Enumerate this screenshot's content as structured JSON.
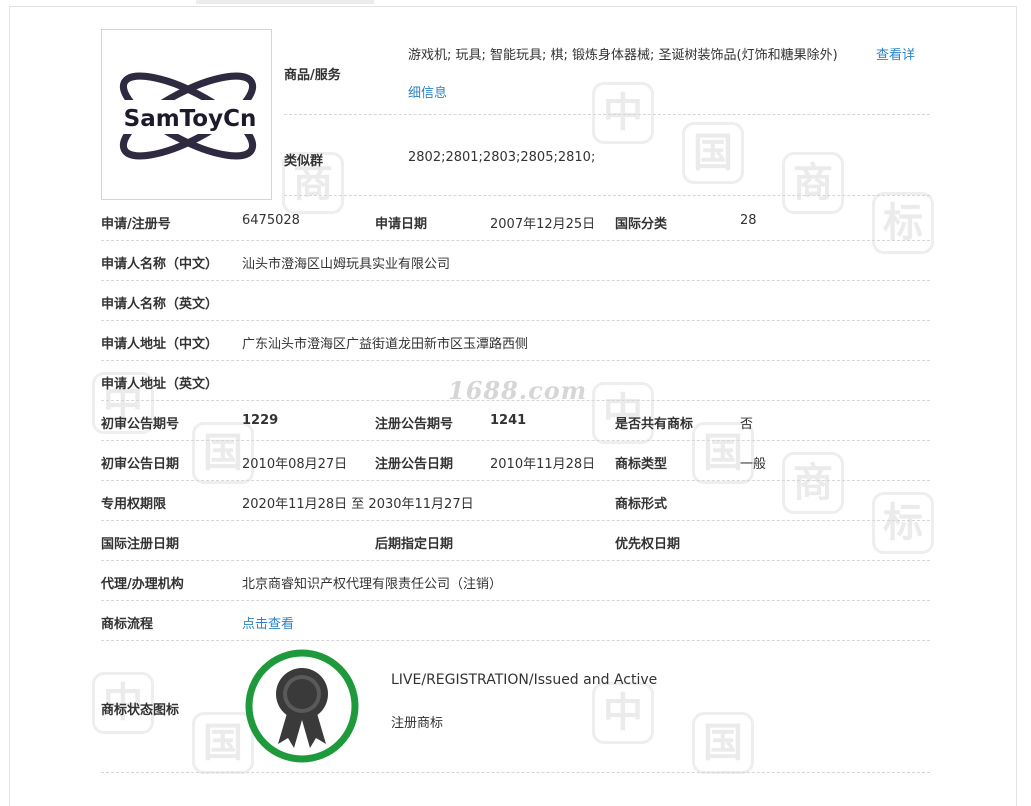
{
  "logo": {
    "text": "SamToyCn"
  },
  "goods": {
    "label": "商品/服务",
    "value": "游戏机; 玩具; 智能玩具; 棋; 锻炼身体器械; 圣诞树装饰品(灯饰和糖果除外)",
    "more_link_1": "查看详",
    "more_link_2": "细信息"
  },
  "similar_group": {
    "label": "类似群",
    "value": "2802;2801;2803;2805;2810;"
  },
  "reg_no": {
    "label": "申请/注册号",
    "value": "6475028"
  },
  "apply_date": {
    "label": "申请日期",
    "value": "2007年12月25日"
  },
  "intl_class": {
    "label": "国际分类",
    "value": "28"
  },
  "applicant_cn": {
    "label": "申请人名称（中文）",
    "value": "汕头市澄海区山姆玩具实业有限公司"
  },
  "applicant_en": {
    "label": "申请人名称（英文）",
    "value": ""
  },
  "address_cn": {
    "label": "申请人地址（中文）",
    "value": "广东汕头市澄海区广益街道龙田新市区玉潭路西侧"
  },
  "address_en": {
    "label": "申请人地址（英文）",
    "value": ""
  },
  "prelim_issue": {
    "label": "初审公告期号",
    "value": "1229"
  },
  "reg_issue": {
    "label": "注册公告期号",
    "value": "1241"
  },
  "shared": {
    "label": "是否共有商标",
    "value": "否"
  },
  "prelim_date": {
    "label": "初审公告日期",
    "value": "2010年08月27日"
  },
  "reg_date": {
    "label": "注册公告日期",
    "value": "2010年11月28日"
  },
  "tm_type": {
    "label": "商标类型",
    "value": "一般"
  },
  "exclusive_period": {
    "label": "专用权期限",
    "value": "2020年11月28日 至 2030年11月27日"
  },
  "tm_form": {
    "label": "商标形式",
    "value": ""
  },
  "intl_reg_date": {
    "label": "国际注册日期",
    "value": ""
  },
  "later_designation": {
    "label": "后期指定日期",
    "value": ""
  },
  "priority_date": {
    "label": "优先权日期",
    "value": ""
  },
  "agency": {
    "label": "代理/办理机构",
    "value": "北京商睿知识产权代理有限责任公司（注销）"
  },
  "flow": {
    "label": "商标流程",
    "link": "点击查看"
  },
  "status": {
    "label": "商标状态图标",
    "status_en": "LIVE/REGISTRATION/Issued and Active",
    "status_cn": "注册商标",
    "badge_ring_color": "#1e9a3c",
    "badge_icon_color": "#3a3a3a"
  },
  "watermark": {
    "site": "1688.com",
    "glyphs": [
      "中",
      "国",
      "商",
      "标"
    ]
  },
  "colors": {
    "link": "#2b83c5",
    "text": "#333333",
    "divider": "#d6d6d6"
  }
}
